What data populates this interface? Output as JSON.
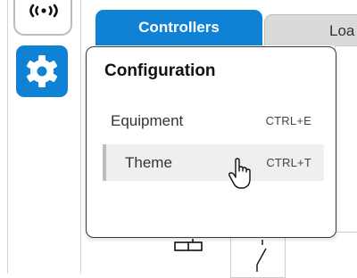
{
  "rail": {
    "signal_icon": "signal-broadcast-icon",
    "settings_icon": "gear-icon",
    "accent": "#0f82d6"
  },
  "tabs": [
    {
      "label": "Controllers",
      "active": true
    },
    {
      "label": "Loa",
      "active": false
    }
  ],
  "menu": {
    "title": "Configuration",
    "items": [
      {
        "label": "Equipment",
        "shortcut": "CTRL+E",
        "hovered": false
      },
      {
        "label": "Theme",
        "shortcut": "CTRL+T",
        "hovered": true
      }
    ]
  },
  "cursor": {
    "icon": "hand-pointer-icon"
  }
}
